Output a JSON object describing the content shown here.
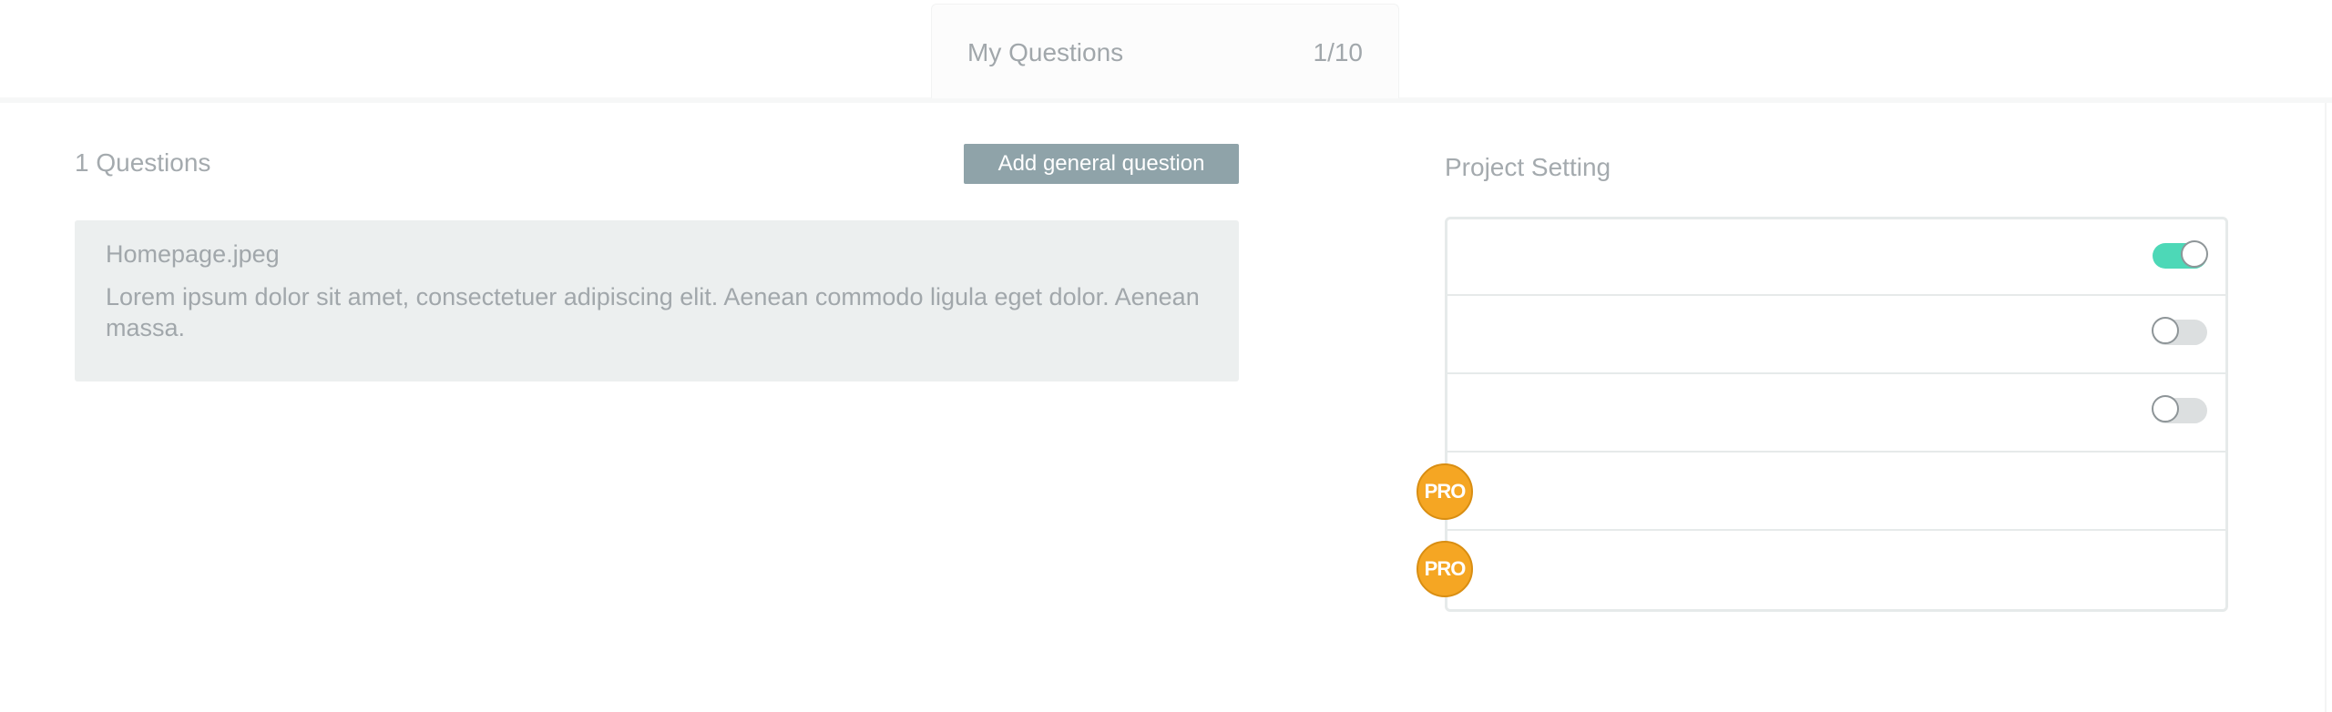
{
  "tab": {
    "title": "My Questions",
    "count": "1/10"
  },
  "questions": {
    "count_label": "1 Questions",
    "add_button_label": "Add general question",
    "items": [
      {
        "title": "Homepage.jpeg",
        "body": "Lorem ipsum dolor sit amet, consectetuer adipiscing elit. Aenean commodo ligula eget dolor. Aenean massa."
      }
    ]
  },
  "settings": {
    "title": "Project Setting",
    "rows": [
      {
        "type": "toggle",
        "state": "on"
      },
      {
        "type": "toggle",
        "state": "off"
      },
      {
        "type": "toggle",
        "state": "off"
      },
      {
        "type": "pro",
        "badge_label": "PRO"
      },
      {
        "type": "pro",
        "badge_label": "PRO"
      }
    ]
  },
  "colors": {
    "toggle_on": "#4dd8b7",
    "pro_badge": "#f5a623",
    "button_bg": "#8fa3a9"
  }
}
